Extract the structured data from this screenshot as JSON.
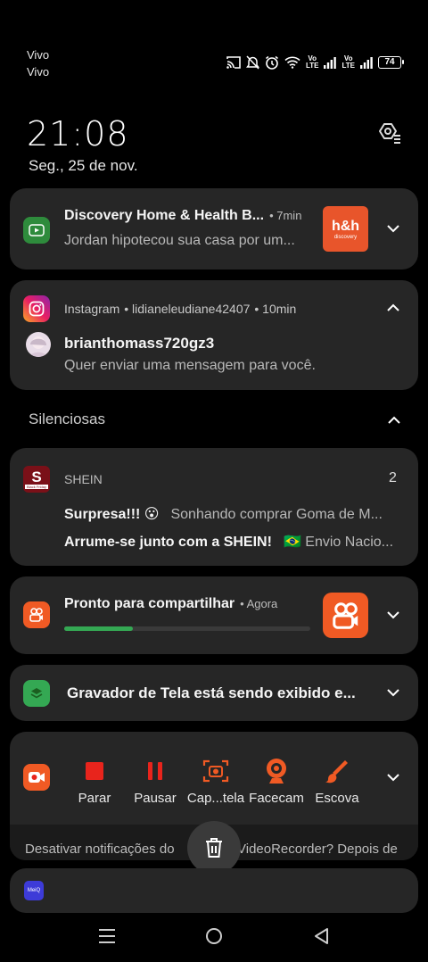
{
  "status_bar": {
    "carrier_1": "Vivo",
    "carrier_2": "Vivo",
    "volte_1": "Vo\nLTE",
    "volte_2": "Vo\nLTE",
    "battery": "74"
  },
  "header": {
    "time": "21:08",
    "date": "Seg., 25 de nov."
  },
  "notifications": {
    "discovery": {
      "title": "Discovery Home & Health B...",
      "time": "• 7min",
      "text": "Jordan hipotecou sua casa por um...",
      "thumb_text": "h&h",
      "thumb_sub": "discovery",
      "color": "#e8552b"
    },
    "instagram": {
      "app": "Instagram",
      "account": "• lidianeleudiane42407",
      "time": "• 10min",
      "sender": "brianthomass720gz3",
      "text": "Quer enviar uma mensagem para você."
    },
    "silent_label": "Silenciosas",
    "shein": {
      "app": "SHEIN",
      "count": "2",
      "line1_bold": "Surpresa!!! 😮",
      "line1_text": "Sonhando comprar Goma de M...",
      "line2_bold": "Arrume-se junto com a SHEIN!",
      "line2_text": "🇧🇷 Envio Nacio..."
    },
    "share": {
      "title": "Pronto para compartilhar",
      "time": "• Agora",
      "progress": 0.28
    },
    "recorder": {
      "title": "Gravador de Tela está sendo exibido e..."
    },
    "controls": {
      "stop": "Parar",
      "pause": "Pausar",
      "capture": "Cap...tela",
      "facecam": "Facecam",
      "brush": "Escova"
    },
    "disable_text": "Desativar notificações do XRecorder? Depois de",
    "disable_left": "Desativar notificações do",
    "disable_right": "VideoRecorder? Depois de",
    "next_app": "MeiQ"
  },
  "colors": {
    "accent_orange": "#f05a24",
    "green": "#34a853",
    "record_red": "#e8241c"
  }
}
